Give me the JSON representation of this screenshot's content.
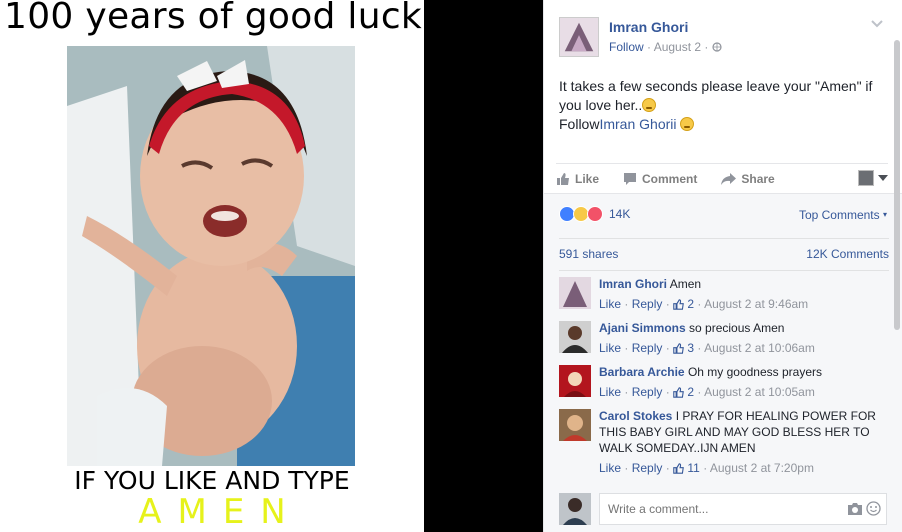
{
  "meme": {
    "title": "100 years of good luck",
    "caption": "IF YOU LIKE AND TYPE",
    "amen": "AMEN"
  },
  "post": {
    "author": "Imran Ghori",
    "follow": "Follow",
    "date": "August 2",
    "text_line1": "It takes a few seconds please leave your \"Amen\" if you love her..",
    "follow_prefix": "Follow",
    "follow_name": "Imran Ghorii"
  },
  "actions": {
    "like": "Like",
    "comment": "Comment",
    "share": "Share"
  },
  "stats": {
    "reactions": "14K",
    "top_comments": "Top Comments",
    "shares": "591 shares",
    "comments": "12K Comments"
  },
  "comments": [
    {
      "name": "Imran Ghori",
      "text": "Amen",
      "like": "Like",
      "reply": "Reply",
      "likes": "2",
      "time": "August 2 at 9:46am"
    },
    {
      "name": "Ajani Simmons",
      "text": "so precious Amen",
      "like": "Like",
      "reply": "Reply",
      "likes": "3",
      "time": "August 2 at 10:06am"
    },
    {
      "name": "Barbara Archie",
      "text": "Oh my goodness prayers",
      "like": "Like",
      "reply": "Reply",
      "likes": "2",
      "time": "August 2 at 10:05am"
    },
    {
      "name": "Carol Stokes",
      "text": "I PRAY FOR HEALING POWER FOR THIS BABY GIRL AND MAY GOD BLESS HER TO WALK SOMEDAY..IJN AMEN",
      "like": "Like",
      "reply": "Reply",
      "likes": "11",
      "time": "August 2 at 7:20pm"
    }
  ],
  "composer": {
    "placeholder": "Write a comment..."
  },
  "colors": {
    "link": "#365899",
    "amen": "#e6f21b",
    "like_reaction": "#4080ff",
    "love_reaction": "#f25268"
  }
}
